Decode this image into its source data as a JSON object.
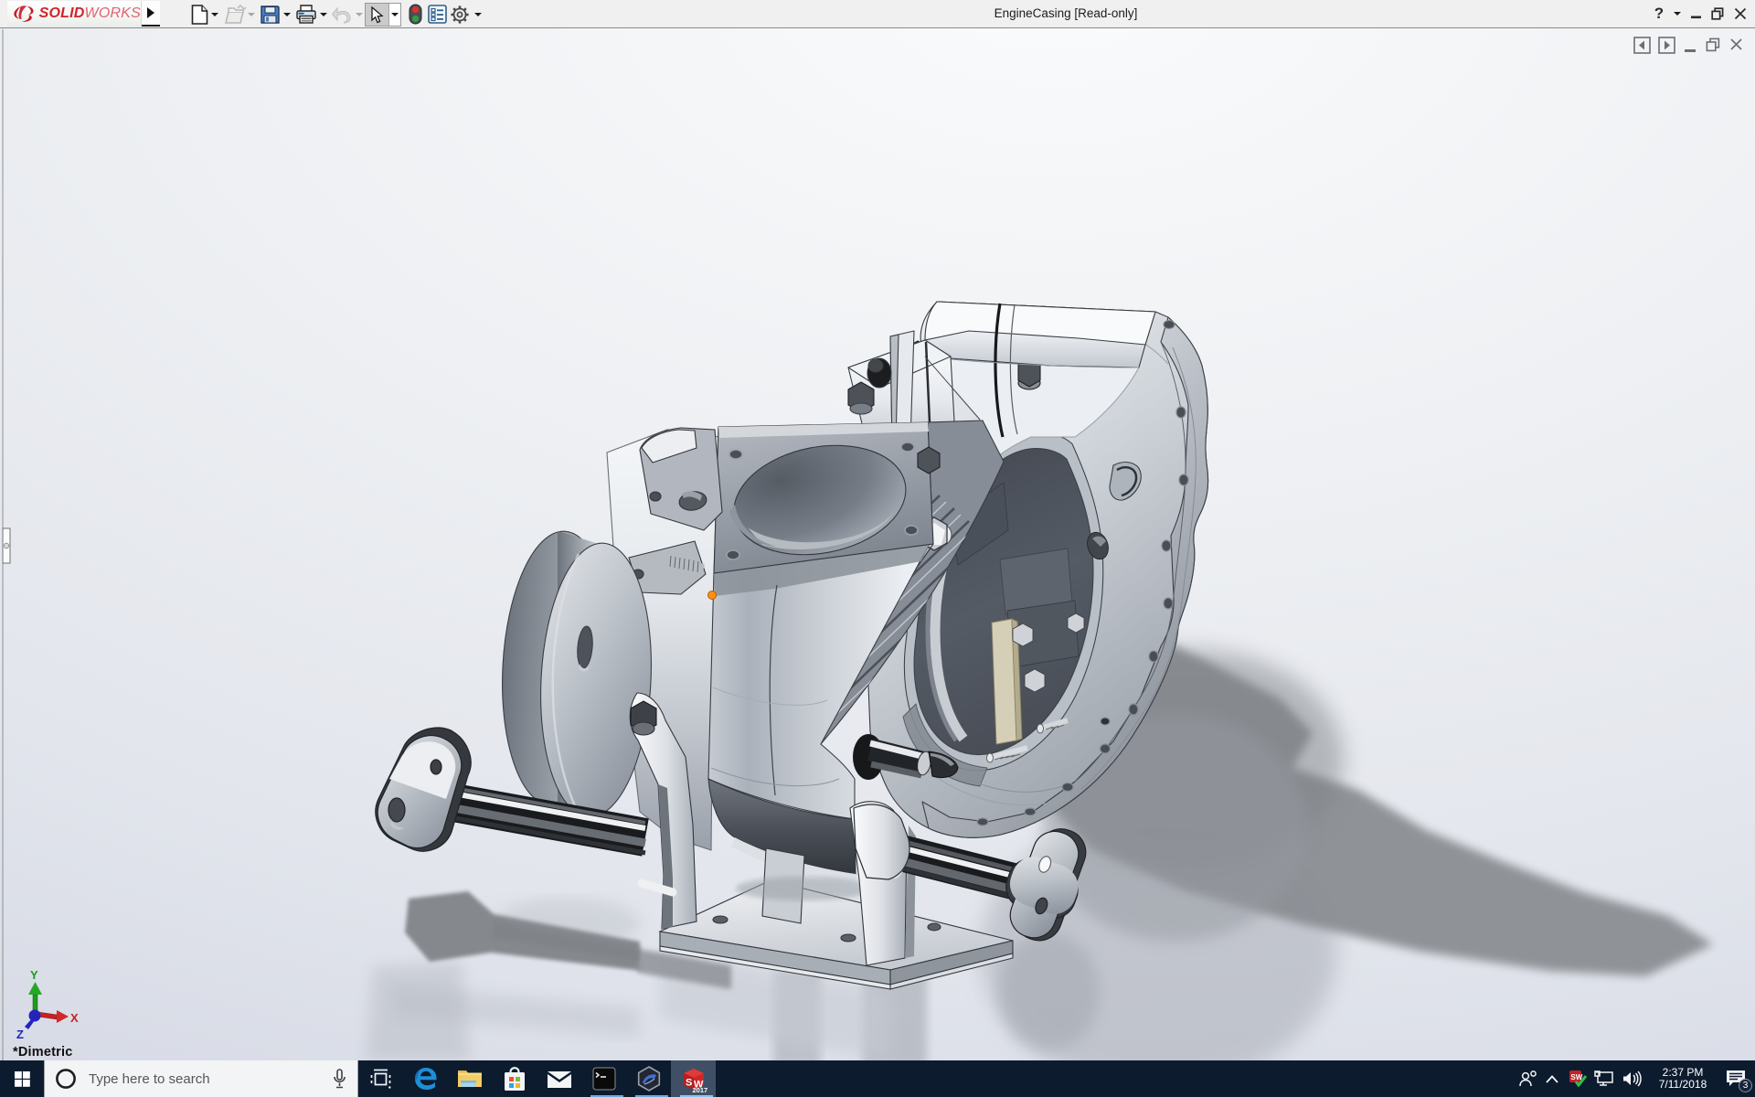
{
  "window": {
    "title": "EngineCasing [Read-only]",
    "help_label": "?",
    "brand_bold": "SOLID",
    "brand_light": "WORKS"
  },
  "toolbar": {
    "buttons": [
      "new",
      "open",
      "save",
      "print",
      "undo",
      "select",
      "rebuild",
      "options-list",
      "settings"
    ]
  },
  "viewport": {
    "orientation_label": "*Dimetric",
    "triad": {
      "x_label": "X",
      "y_label": "Y",
      "z_label": "Z"
    },
    "selection_marker_color": "#ff9015",
    "model_name": "EngineCasing"
  },
  "taskbar": {
    "search_placeholder": "Type here to search",
    "apps": [
      "task-view",
      "edge",
      "file-explorer",
      "store",
      "mail",
      "command-prompt",
      "3d-viewer",
      "solidworks-2017"
    ],
    "running_apps": [
      "command-prompt",
      "3d-viewer",
      "solidworks-2017"
    ],
    "active_app": "solidworks-2017",
    "sw_icon": {
      "s": "S",
      "w": "W",
      "year": "2017",
      "tray_letters": "SW"
    },
    "clock": {
      "time": "2:37 PM",
      "date": "7/11/2018"
    },
    "notification_count": "3",
    "colors": {
      "taskbar_bg": "#0d1b2e",
      "active_slot": "#3f5066",
      "underline": "#6aabdd"
    }
  },
  "colors": {
    "solidworks_red": "#d2232a",
    "toolbar_bg": "#f0f0f0",
    "viewport_top": "#f7f8fa",
    "viewport_bottom": "#d8dce6"
  }
}
